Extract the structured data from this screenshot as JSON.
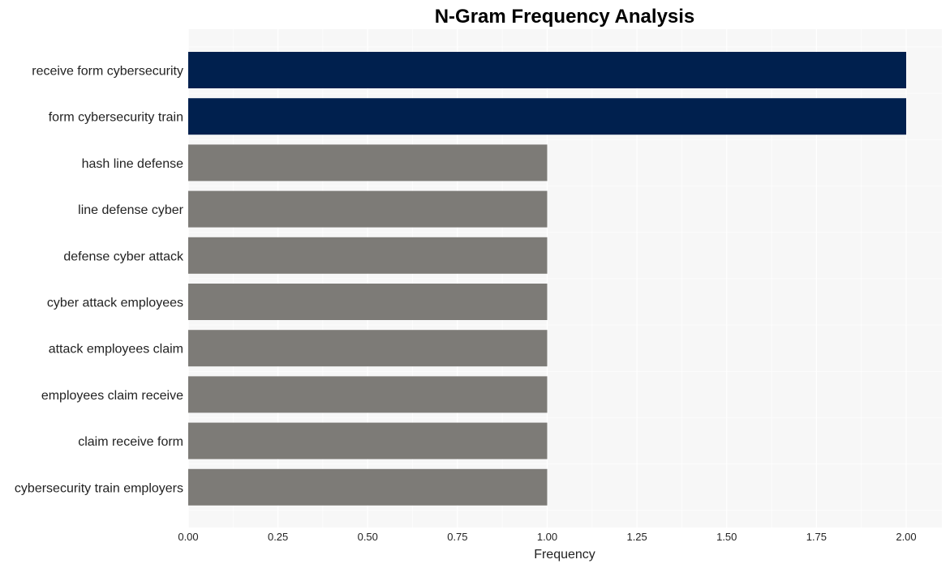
{
  "chart_data": {
    "type": "bar",
    "orientation": "horizontal",
    "title": "N-Gram Frequency Analysis",
    "xlabel": "Frequency",
    "ylabel": "",
    "xlim": [
      0,
      2.1
    ],
    "xticks": [
      "0.00",
      "0.25",
      "0.50",
      "0.75",
      "1.00",
      "1.25",
      "1.50",
      "1.75",
      "2.00"
    ],
    "xtick_values": [
      0,
      0.25,
      0.5,
      0.75,
      1.0,
      1.25,
      1.5,
      1.75,
      2.0
    ],
    "grid": true,
    "categories": [
      "receive form cybersecurity",
      "form cybersecurity train",
      "hash line defense",
      "line defense cyber",
      "defense cyber attack",
      "cyber attack employees",
      "attack employees claim",
      "employees claim receive",
      "claim receive form",
      "cybersecurity train employers"
    ],
    "values": [
      2,
      2,
      1,
      1,
      1,
      1,
      1,
      1,
      1,
      1
    ],
    "colors": {
      "highlight": "#00204e",
      "default": "#7d7b77",
      "plot_background": "#f7f7f7",
      "grid": "#ffffff"
    }
  }
}
